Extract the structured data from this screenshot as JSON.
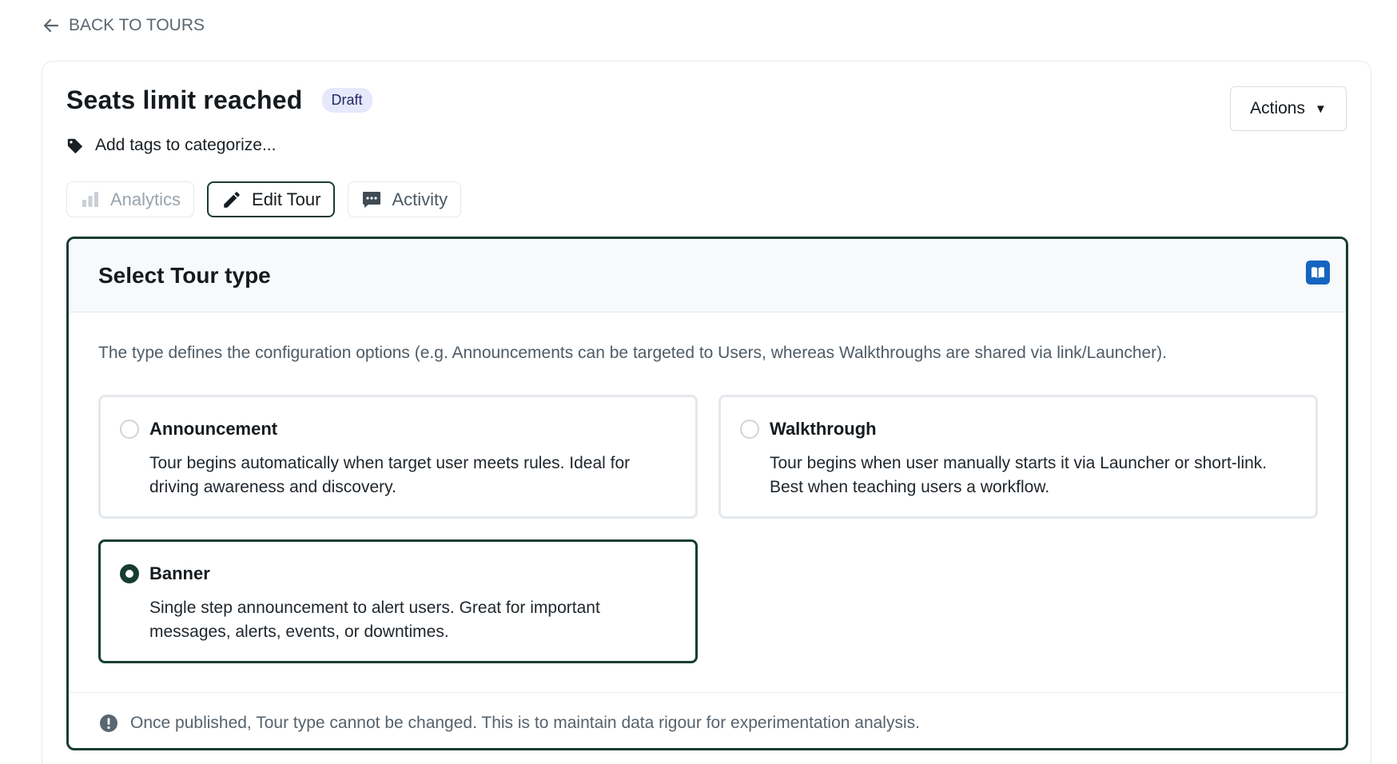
{
  "nav": {
    "back_label": "BACK TO TOURS"
  },
  "header": {
    "title": "Seats limit reached",
    "status_badge": "Draft",
    "actions_label": "Actions",
    "actions_caret": "▼",
    "tags_placeholder": "Add tags to categorize..."
  },
  "tabs": [
    {
      "label": "Analytics",
      "icon": "bar-chart-icon",
      "state": "disabled"
    },
    {
      "label": "Edit Tour",
      "icon": "pencil-icon",
      "state": "active"
    },
    {
      "label": "Activity",
      "icon": "chat-bubble-icon",
      "state": "default"
    }
  ],
  "panel": {
    "title": "Select Tour type",
    "help_icon": "book-icon",
    "description": "The type defines the configuration options (e.g. Announcements can be targeted to Users, whereas Walkthroughs are shared via link/Launcher).",
    "options": [
      {
        "title": "Announcement",
        "description": "Tour begins automatically when target user meets rules. Ideal for driving awareness and discovery.",
        "selected": false
      },
      {
        "title": "Walkthrough",
        "description": "Tour begins when user manually starts it via Launcher or short-link. Best when teaching users a workflow.",
        "selected": false
      },
      {
        "title": "Banner",
        "description": "Single step announcement to alert users. Great for important messages, alerts, events, or downtimes.",
        "selected": true
      }
    ],
    "footer_note": "Once published, Tour type cannot be changed. This is to maintain data rigour for experimentation analysis."
  },
  "colors": {
    "accent_dark_green": "#173d33",
    "badge_bg": "#e6e8fb",
    "help_icon_blue": "#1565c0"
  }
}
